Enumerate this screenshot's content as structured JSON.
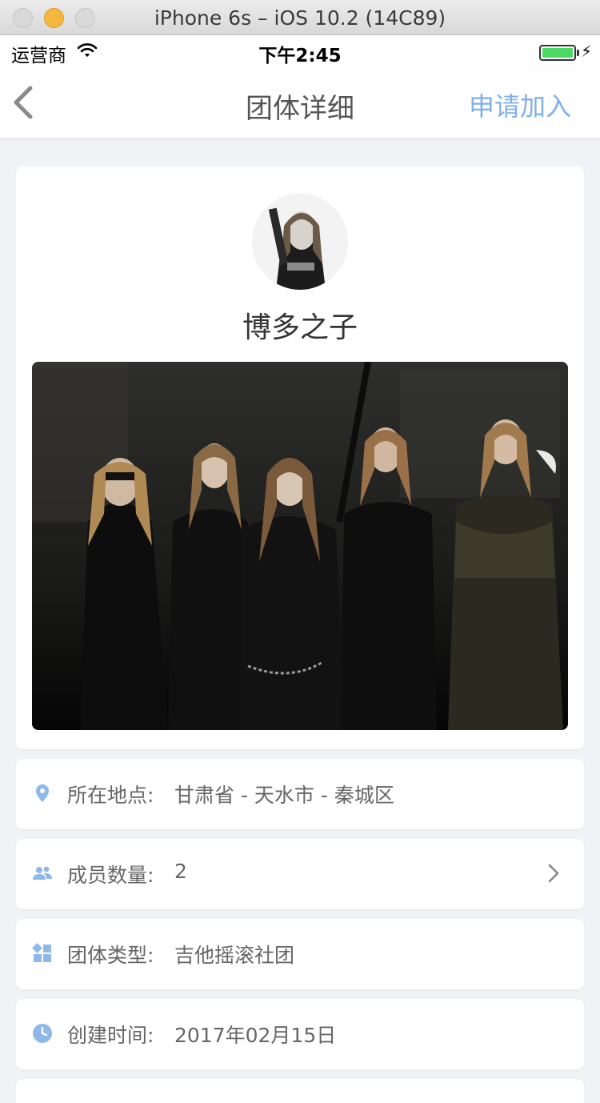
{
  "window": {
    "title": "iPhone 6s – iOS 10.2 (14C89)"
  },
  "status_bar": {
    "carrier": "运营商",
    "time": "下午2:45"
  },
  "nav": {
    "title": "团体详细",
    "action": "申请加入"
  },
  "group": {
    "name": "博多之子"
  },
  "info": [
    {
      "label": "所在地点:",
      "value": "甘肃省 - 天水市 - 秦城区",
      "icon": "location-pin-icon"
    },
    {
      "label": "成员数量:",
      "value": "2",
      "icon": "members-icon"
    },
    {
      "label": "团体类型:",
      "value": "吉他摇滚社团",
      "icon": "category-grid-icon"
    },
    {
      "label": "创建时间:",
      "value": "2017年02月15日",
      "icon": "clock-icon"
    }
  ],
  "colors": {
    "accent": "#7fb0ea",
    "icon": "#8fb8ea",
    "background": "#f0f2f5"
  }
}
